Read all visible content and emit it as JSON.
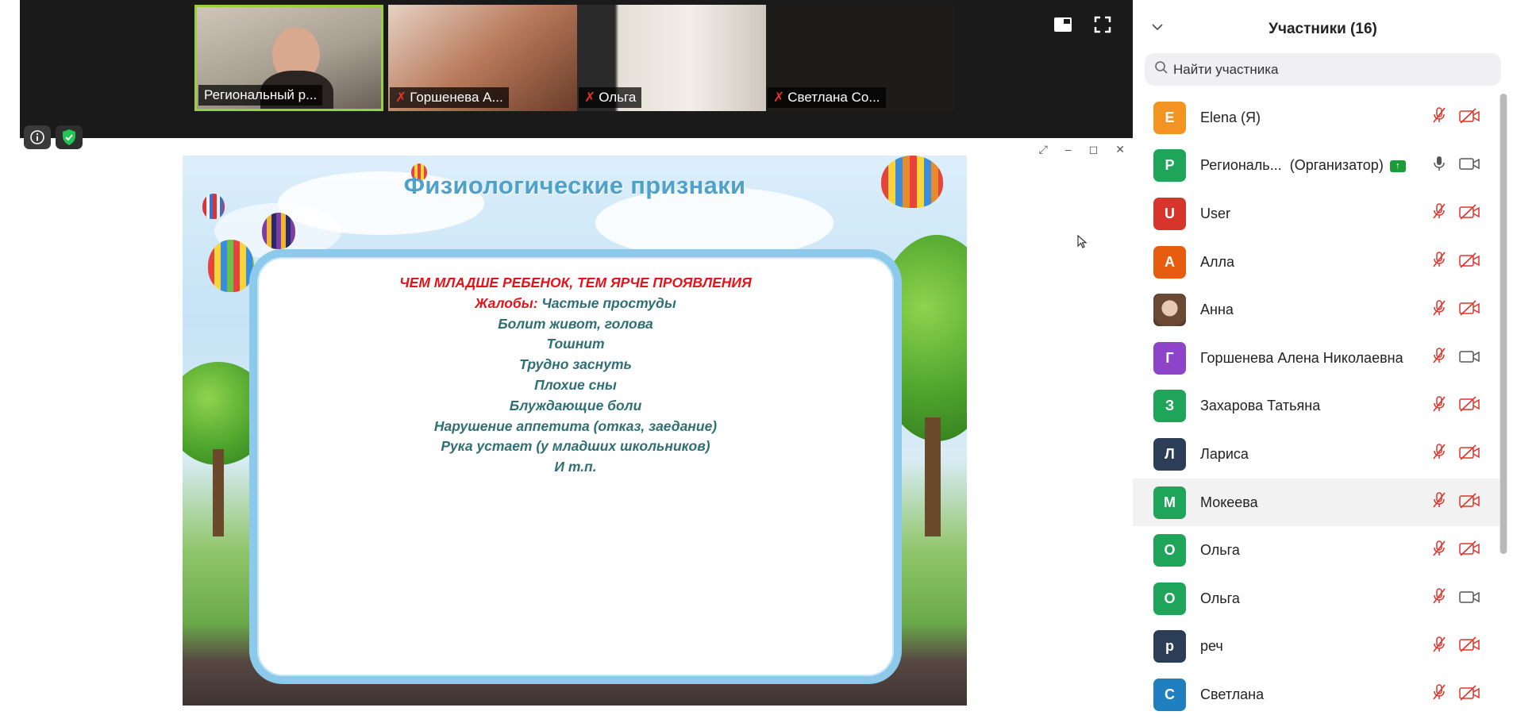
{
  "video_strip": {
    "tiles": [
      {
        "name": "Региональный р...",
        "muted": false
      },
      {
        "name": "Горшенева А...",
        "muted": true
      },
      {
        "name": "Ольга",
        "muted": true
      },
      {
        "name": "Светлана Со...",
        "muted": true
      }
    ]
  },
  "slide": {
    "title": "Физиологические признаки",
    "headline": "ЧЕМ МЛАДШЕ РЕБЕНОК, ТЕМ ЯРЧЕ ПРОЯВЛЕНИЯ",
    "complaints_label": "Жалобы:",
    "complaints_first": "Частые простуды",
    "lines": [
      "Болит живот, голова",
      "Тошнит",
      "Трудно заснуть",
      "Плохие сны",
      "Блуждающие боли",
      "Нарушение аппетита (отказ, заедание)",
      "Рука устает (у младших школьников)",
      "И т.п."
    ]
  },
  "panel": {
    "title": "Участники (16)",
    "search_placeholder": "Найти участника",
    "participants": [
      {
        "initial": "E",
        "name": "Elena (Я)",
        "color": "#f29322",
        "mic": "muted",
        "cam": "off"
      },
      {
        "initial": "Р",
        "name": "Региональ...",
        "role": "(Организатор)",
        "color": "#1fa55a",
        "mic": "on",
        "cam": "on",
        "sharing": true
      },
      {
        "initial": "U",
        "name": "User",
        "color": "#d7352b",
        "mic": "muted",
        "cam": "off"
      },
      {
        "initial": "А",
        "name": "Алла",
        "color": "#e65d0f",
        "mic": "muted",
        "cam": "off"
      },
      {
        "initial": "",
        "name": "Анна",
        "color": "#a68b76",
        "mic": "muted",
        "cam": "off",
        "photo": true
      },
      {
        "initial": "Г",
        "name": "Горшенева Алена Николаевна",
        "color": "#8e44c9",
        "mic": "muted",
        "cam": "on"
      },
      {
        "initial": "З",
        "name": "Захарова Татьяна",
        "color": "#1fa55a",
        "mic": "muted",
        "cam": "off"
      },
      {
        "initial": "Л",
        "name": "Лариса",
        "color": "#2c3e57",
        "mic": "muted",
        "cam": "off"
      },
      {
        "initial": "М",
        "name": "Мокеева",
        "color": "#1fa55a",
        "mic": "muted",
        "cam": "off",
        "highlight": true
      },
      {
        "initial": "О",
        "name": "Ольга",
        "color": "#1fa55a",
        "mic": "muted",
        "cam": "off"
      },
      {
        "initial": "О",
        "name": "Ольга",
        "color": "#1fa55a",
        "mic": "muted",
        "cam": "on"
      },
      {
        "initial": "р",
        "name": "реч",
        "color": "#2c3e57",
        "mic": "muted",
        "cam": "off"
      },
      {
        "initial": "С",
        "name": "Светлана",
        "color": "#1f7fc1",
        "mic": "muted",
        "cam": "off"
      }
    ]
  }
}
